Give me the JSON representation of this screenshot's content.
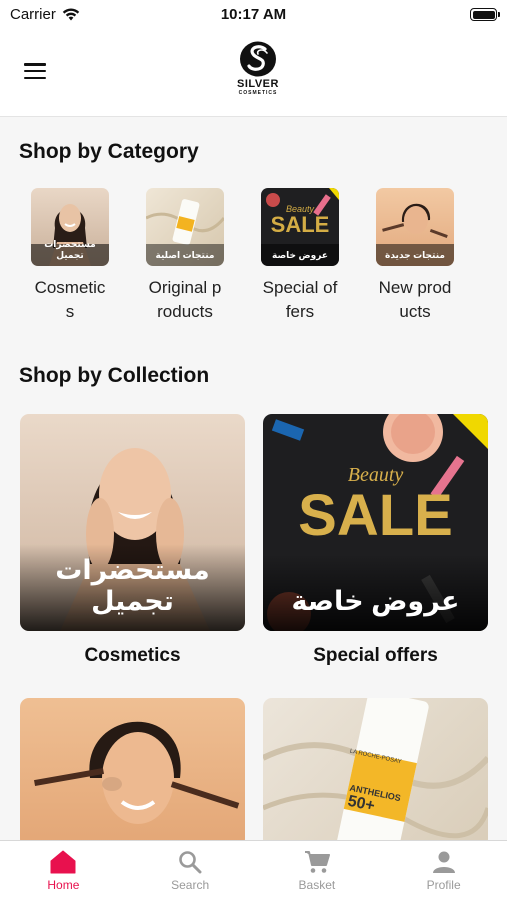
{
  "status_bar": {
    "carrier": "Carrier",
    "time": "10:17 AM"
  },
  "header": {
    "logo_word": "SILVER",
    "logo_sub": "COSMETICS"
  },
  "category_section": {
    "title": "Shop by Category",
    "items": [
      {
        "thumb_caption": "مستحضرات تجميل",
        "label": "Cosmetics"
      },
      {
        "thumb_caption": "منتجات اصلية",
        "label": "Original products"
      },
      {
        "thumb_caption": "عروض خاصة",
        "label": "Special offers",
        "sale_small": "Beauty",
        "sale_big": "SALE"
      },
      {
        "thumb_caption": "منتجات جديدة",
        "label": "New products"
      }
    ]
  },
  "collection_section": {
    "title": "Shop by Collection",
    "cards": [
      {
        "caption": "مستحضرات تجميل",
        "title": "Cosmetics"
      },
      {
        "caption": "عروض خاصة",
        "title": "Special offers",
        "sale_small": "Beauty",
        "sale_big": "SALE"
      },
      {
        "caption": "",
        "title": ""
      },
      {
        "caption": "",
        "title": "",
        "product_brand": "LA ROCHE-POSAY",
        "product_name": "ANTHELIOS",
        "product_spf": "50+"
      }
    ]
  },
  "tab_bar": {
    "tabs": [
      {
        "label": "Home",
        "icon": "home-icon",
        "active": true
      },
      {
        "label": "Search",
        "icon": "search-icon",
        "active": false
      },
      {
        "label": "Basket",
        "icon": "cart-icon",
        "active": false
      },
      {
        "label": "Profile",
        "icon": "profile-icon",
        "active": false
      }
    ]
  },
  "colors": {
    "accent": "#e8114e",
    "inactive": "#9a9a9a",
    "background": "#f6f6f6"
  }
}
